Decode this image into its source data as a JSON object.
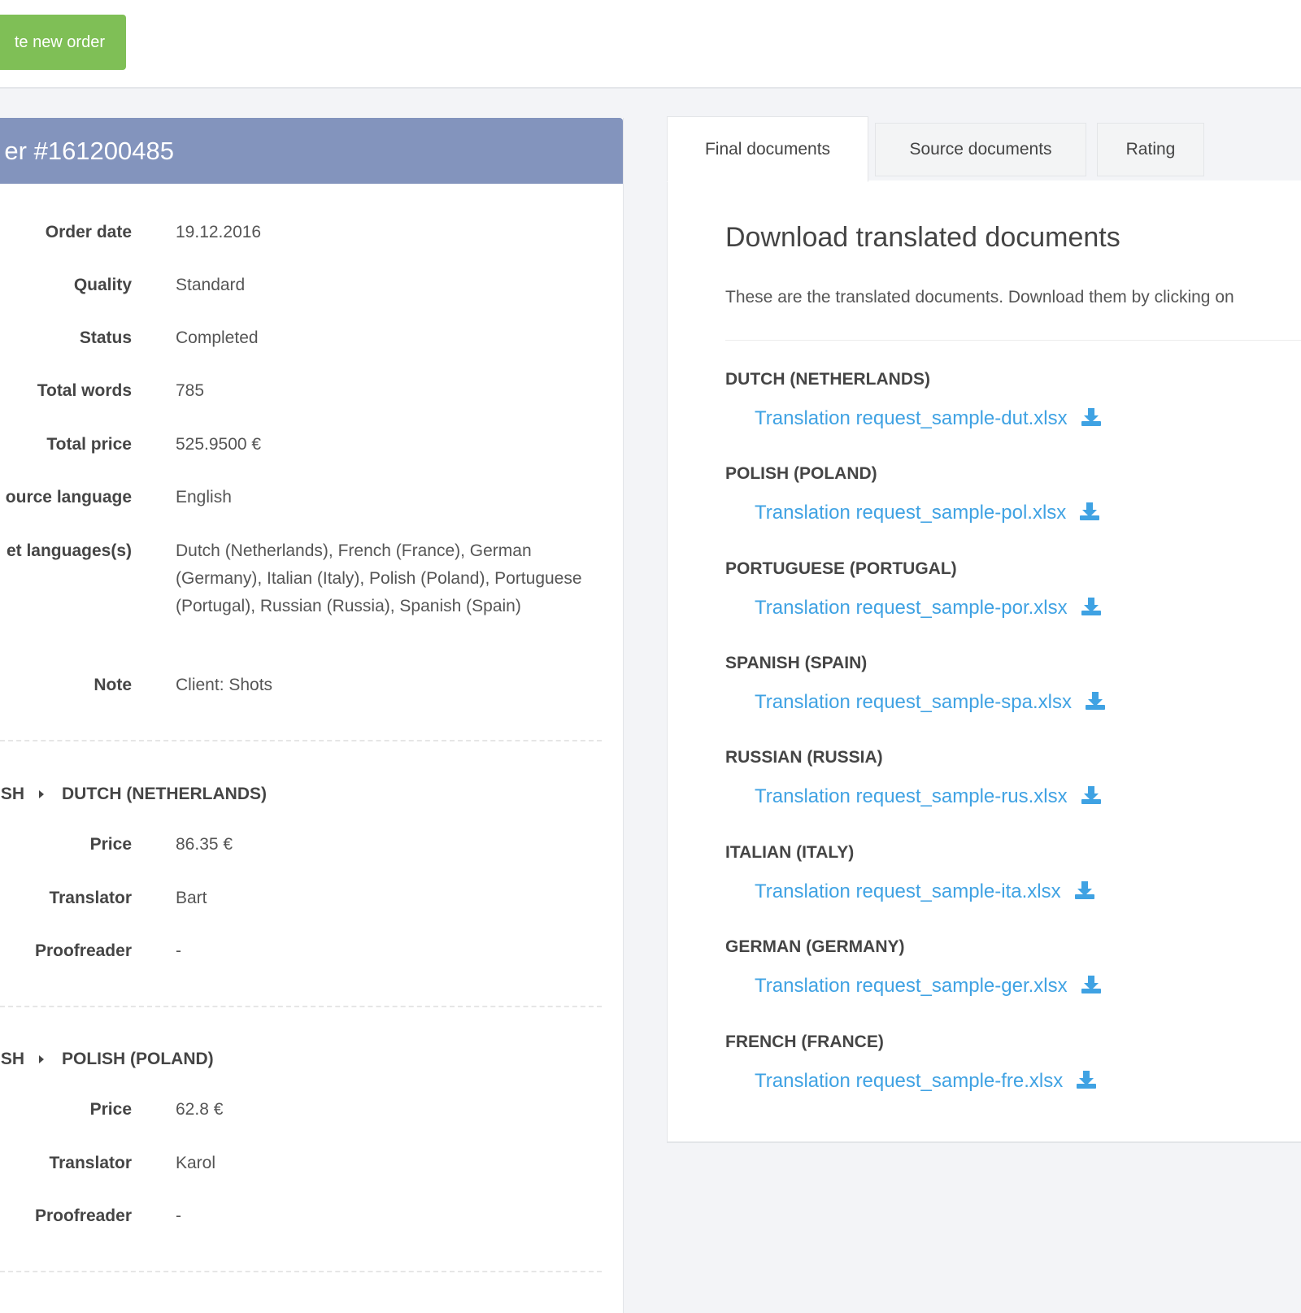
{
  "toolbar": {
    "new_order_label": "te new order"
  },
  "order": {
    "title": "er #161200485",
    "fields": [
      {
        "label": "Order date",
        "value": "19.12.2016"
      },
      {
        "label": "Quality",
        "value": "Standard"
      },
      {
        "label": "Status",
        "value": "Completed"
      },
      {
        "label": "Total words",
        "value": "785"
      },
      {
        "label": "Total price",
        "value": "525.9500 €"
      },
      {
        "label": "ource language",
        "value": "English"
      },
      {
        "label": "et languages(s)",
        "value": "Dutch (Netherlands), French (France), German (Germany), Italian (Italy), Polish (Poland), Portuguese (Portugal), Russian (Russia), Spanish (Spain)"
      },
      {
        "label": "Note",
        "value": "Client: Shots"
      }
    ],
    "pairs": [
      {
        "source": "SH",
        "target": "DUTCH (NETHERLANDS)",
        "rows": [
          {
            "label": "Price",
            "value": "86.35 €"
          },
          {
            "label": "Translator",
            "value": "Bart"
          },
          {
            "label": "Proofreader",
            "value": "-"
          }
        ]
      },
      {
        "source": "SH",
        "target": "POLISH (POLAND)",
        "rows": [
          {
            "label": "Price",
            "value": "62.8 €"
          },
          {
            "label": "Translator",
            "value": "Karol"
          },
          {
            "label": "Proofreader",
            "value": "-"
          }
        ]
      }
    ]
  },
  "tabs": {
    "final": "Final documents",
    "source": "Source documents",
    "rating": "Rating"
  },
  "docs": {
    "title": "Download translated documents",
    "description": "These are the translated documents. Download them by clicking on",
    "languages": [
      {
        "name": "DUTCH (NETHERLANDS)",
        "file": "Translation request_sample-dut.xlsx"
      },
      {
        "name": "POLISH (POLAND)",
        "file": "Translation request_sample-pol.xlsx"
      },
      {
        "name": "PORTUGUESE (PORTUGAL)",
        "file": "Translation request_sample-por.xlsx"
      },
      {
        "name": "SPANISH (SPAIN)",
        "file": "Translation request_sample-spa.xlsx"
      },
      {
        "name": "RUSSIAN (RUSSIA)",
        "file": "Translation request_sample-rus.xlsx"
      },
      {
        "name": "ITALIAN (ITALY)",
        "file": "Translation request_sample-ita.xlsx"
      },
      {
        "name": "GERMAN (GERMANY)",
        "file": "Translation request_sample-ger.xlsx"
      },
      {
        "name": "FRENCH (FRANCE)",
        "file": "Translation request_sample-fre.xlsx"
      }
    ],
    "download_icon": "download-icon"
  },
  "colors": {
    "accent_green": "#7fbf56",
    "header_blue": "#8394bd",
    "link_blue": "#3fa2e3"
  }
}
